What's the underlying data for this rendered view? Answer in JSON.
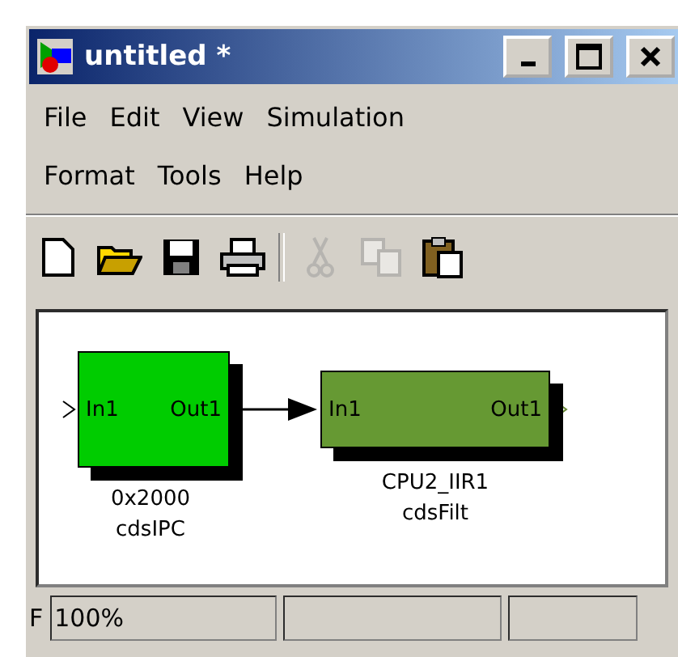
{
  "window": {
    "title": "untitled *"
  },
  "menu_rows": [
    [
      {
        "label": "File"
      },
      {
        "label": "Edit"
      },
      {
        "label": "View"
      },
      {
        "label": "Simulation"
      }
    ],
    [
      {
        "label": "Format"
      },
      {
        "label": "Tools"
      },
      {
        "label": "Help"
      }
    ]
  ],
  "toolbar": [
    {
      "kind": "new",
      "disabled": false
    },
    {
      "kind": "open",
      "disabled": false
    },
    {
      "kind": "save",
      "disabled": false
    },
    {
      "kind": "print",
      "disabled": false
    },
    {
      "kind": "separator"
    },
    {
      "kind": "cut",
      "disabled": true
    },
    {
      "kind": "copy",
      "disabled": true
    },
    {
      "kind": "paste",
      "disabled": false
    }
  ],
  "blocks": [
    {
      "in_port": "In1",
      "out_port": "Out1",
      "label_lines": [
        "0x2000",
        "cdsIPC"
      ],
      "color": "#00cc00"
    },
    {
      "in_port": "In1",
      "out_port": "Out1",
      "label_lines": [
        "CPU2_IIR1",
        "cdsFilt"
      ],
      "color": "#669933"
    }
  ],
  "status_bar": {
    "cut_text": "F",
    "zoom": "100%"
  }
}
